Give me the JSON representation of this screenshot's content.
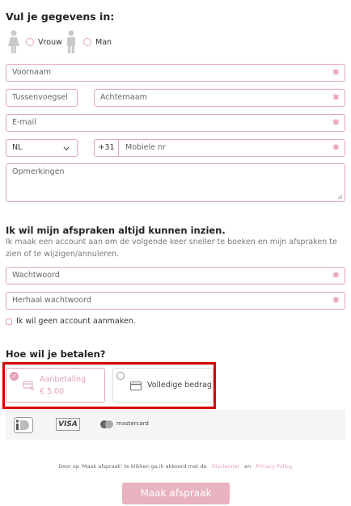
{
  "heading": "Vul je gegevens in:",
  "gender": {
    "options": [
      {
        "label": "Vrouw"
      },
      {
        "label": "Man"
      }
    ]
  },
  "fields": {
    "voornaam": "Voornaam",
    "tussenvoegsel": "Tussenvoegsel",
    "achternaam": "Achternaam",
    "email": "E-mail",
    "country_code": "NL",
    "dial_prefix": "+31",
    "mobile": "Mobiele nr",
    "remarks": "Opmerkingen"
  },
  "account": {
    "heading": "Ik wil mijn afspraken altijd kunnen inzien.",
    "description": "Ik maak een account aan om de volgende keer sneller te boeken en mijn afspraken te zien of te wijzigen/annuleren.",
    "password": "Wachtwoord",
    "password_repeat": "Herhaal wachtwoord",
    "no_account_label": "Ik wil geen account aanmaken."
  },
  "payment": {
    "heading": "Hoe wil je betalen?",
    "options": [
      {
        "title": "Aanbetaling",
        "amount": "€ 5,00",
        "selected": true
      },
      {
        "title": "Volledige bedrag",
        "selected": false
      }
    ],
    "methods": [
      "iDEAL",
      "VISA",
      "mastercard"
    ]
  },
  "terms": {
    "prefix": "Door op 'Maak afspraak' te klikken ga ik akkoord met de",
    "disclaimer": "Disclaimer",
    "and": "en",
    "privacy": "Privacy Policy",
    "suffix": "."
  },
  "submit_label": "Maak afspraak",
  "colors": {
    "accent": "#e3a6b6",
    "selected_text": "#e6a2b3",
    "highlight": "#d40000",
    "button": "#e8b2bf"
  }
}
